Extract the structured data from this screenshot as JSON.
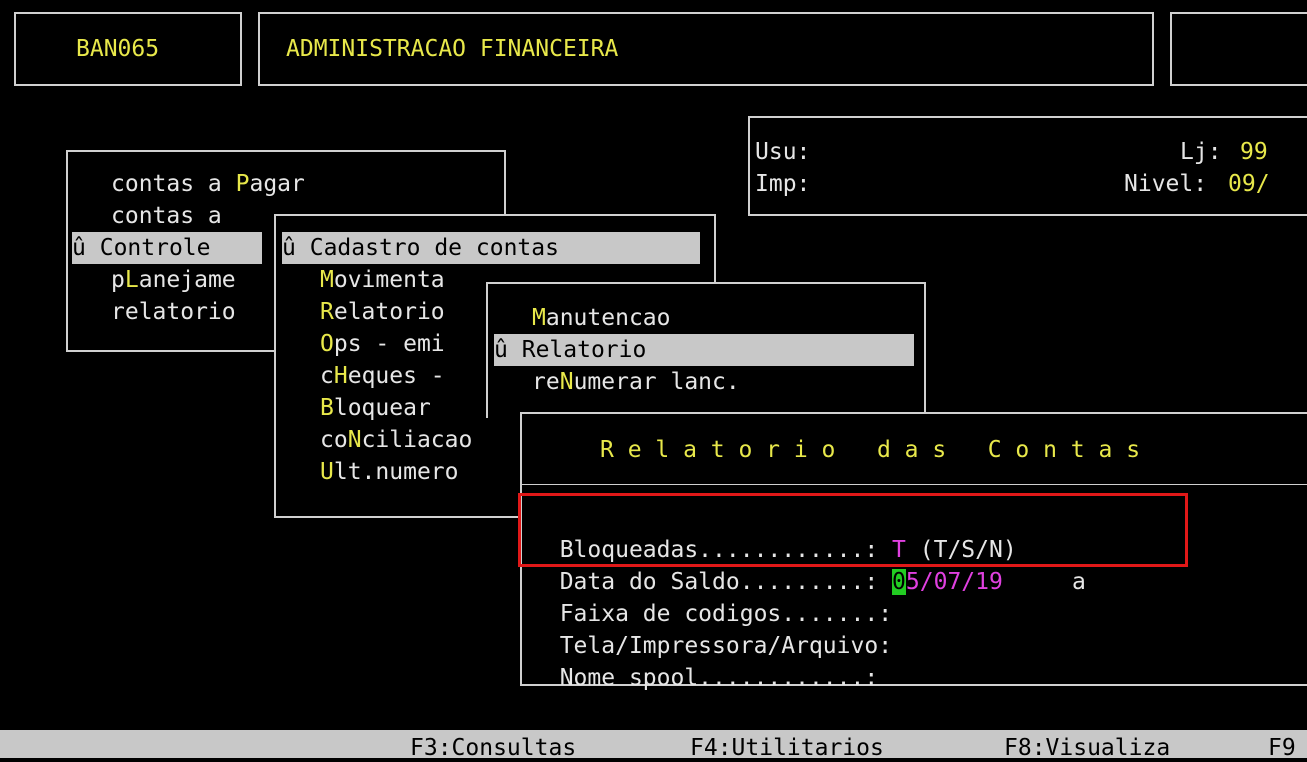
{
  "header": {
    "program_code": "BAN065",
    "title": "ADMINISTRACAO FINANCEIRA"
  },
  "info_panel": {
    "usu_label": "Usu:",
    "imp_label": "Imp:",
    "lj_label": "Lj:",
    "lj_value": "99",
    "nivel_label": "Nivel:",
    "nivel_value": "09/"
  },
  "main_menu": {
    "items": [
      {
        "prefix": "contas a ",
        "hot": "P",
        "suffix": "agar",
        "selected": false
      },
      {
        "prefix": "contas a",
        "hot": "",
        "suffix": "",
        "selected": false
      },
      {
        "mark": "û ",
        "prefix": "",
        "hot": "C",
        "suffix": "ontrole",
        "selected": true
      },
      {
        "prefix": "p",
        "hot": "L",
        "suffix": "anejame",
        "selected": false
      },
      {
        "prefix": "",
        "hot": "",
        "suffix": "relatorio",
        "selected": false
      }
    ]
  },
  "sub_menu": {
    "items": [
      {
        "mark": "û ",
        "prefix": "",
        "hot": "C",
        "suffix": "adastro de contas",
        "selected": true
      },
      {
        "prefix": "",
        "hot": "M",
        "suffix": "ovimenta",
        "selected": false
      },
      {
        "prefix": "",
        "hot": "R",
        "suffix": "elatorio",
        "selected": false
      },
      {
        "prefix": "",
        "hot": "O",
        "suffix": "ps - emi",
        "selected": false
      },
      {
        "prefix": "c",
        "hot": "H",
        "suffix": "eques -",
        "selected": false
      },
      {
        "prefix": "",
        "hot": "B",
        "suffix": "loquear",
        "selected": false
      },
      {
        "prefix": "co",
        "hot": "N",
        "suffix": "ciliacao",
        "selected": false
      },
      {
        "prefix": "",
        "hot": "U",
        "suffix": "lt.numero",
        "selected": false
      }
    ]
  },
  "sub_sub_menu": {
    "items": [
      {
        "prefix": "",
        "hot": "M",
        "suffix": "anutencao",
        "selected": false
      },
      {
        "mark": "û ",
        "prefix": "",
        "hot": "R",
        "suffix": "elatorio",
        "selected": true
      },
      {
        "prefix": "re",
        "hot": "N",
        "suffix": "umerar lanc.",
        "selected": false
      }
    ]
  },
  "report_dialog": {
    "title": "R e l a t o r i o   d a s   C o n t a s",
    "fields": {
      "bloqueadas_label": "Bloqueadas............: ",
      "bloqueadas_value": "T",
      "bloqueadas_hint": " (T/S/N)",
      "data_saldo_label": "Data do Saldo.........: ",
      "data_saldo_cursor_char": "0",
      "data_saldo_rest": "5/07/19",
      "faixa_label": "Faixa de codigos.......:",
      "faixa_sep": "a",
      "tela_label": "Tela/Impressora/Arquivo:",
      "spool_label": "Nome spool............:"
    }
  },
  "status_bar": {
    "keys": [
      "F3:Consultas",
      "F4:Utilitarios",
      "F8:Visualiza",
      "F9"
    ]
  },
  "colors": {
    "background": "#000000",
    "menu_hotkey": "#e8e84a",
    "selection_bg": "#c8c8c8",
    "value": "#e040e0",
    "cursor": "#22cc22",
    "annotation": "#e01818"
  }
}
